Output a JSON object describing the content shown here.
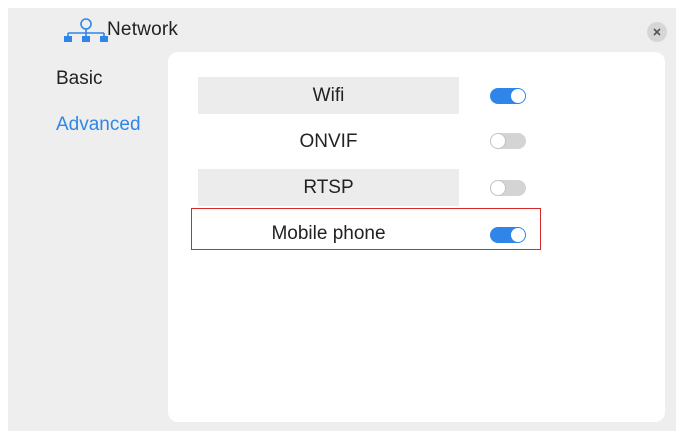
{
  "window": {
    "title": "Network",
    "title_icon": "network-topology-icon",
    "close_icon": "close-icon"
  },
  "sidebar": {
    "items": [
      {
        "label": "Basic",
        "selected": false
      },
      {
        "label": "Advanced",
        "selected": true
      }
    ]
  },
  "settings": {
    "rows": [
      {
        "label": "Wifi",
        "enabled": true
      },
      {
        "label": "ONVIF",
        "enabled": false
      },
      {
        "label": "RTSP",
        "enabled": false
      },
      {
        "label": "Mobile phone",
        "enabled": true,
        "highlighted": true
      }
    ]
  },
  "colors": {
    "accent": "#2f86e8",
    "toggle_off": "#d4d4d4",
    "highlight_border": "#d42a2a",
    "panel_bg": "#ffffff",
    "window_bg": "#eeeeee"
  }
}
